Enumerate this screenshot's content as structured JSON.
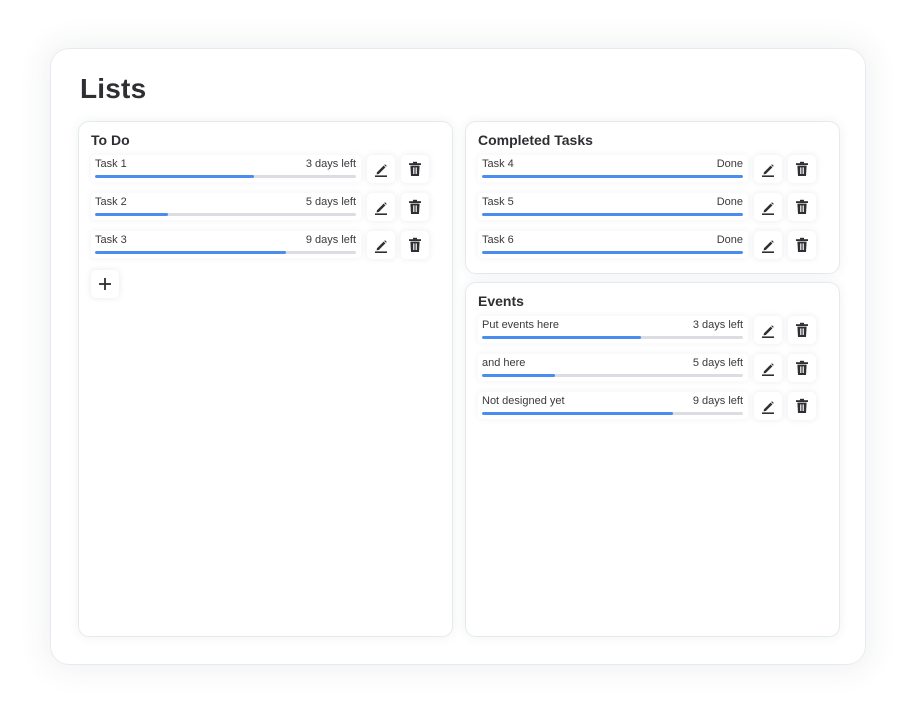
{
  "page": {
    "title": "Lists"
  },
  "colors": {
    "accent": "#4a8cf0",
    "track": "#dcdde2",
    "text": "#2f2f33"
  },
  "icons": {
    "edit": "pencil-icon",
    "delete": "trash-icon",
    "add": "plus-icon"
  },
  "lists": {
    "todo": {
      "title": "To Do",
      "items": [
        {
          "name": "Task 1",
          "status": "3 days left",
          "progress": 0.61
        },
        {
          "name": "Task 2",
          "status": "5 days left",
          "progress": 0.28
        },
        {
          "name": "Task 3",
          "status": "9 days left",
          "progress": 0.73
        }
      ]
    },
    "completed": {
      "title": "Completed Tasks",
      "items": [
        {
          "name": "Task 4",
          "status": "Done",
          "progress": 1.0
        },
        {
          "name": "Task 5",
          "status": "Done",
          "progress": 1.0
        },
        {
          "name": "Task 6",
          "status": "Done",
          "progress": 1.0
        }
      ]
    },
    "events": {
      "title": "Events",
      "items": [
        {
          "name": "Put events here",
          "status": "3 days left",
          "progress": 0.61
        },
        {
          "name": "and here",
          "status": "5 days left",
          "progress": 0.28
        },
        {
          "name": "Not designed yet",
          "status": "9 days left",
          "progress": 0.73
        }
      ]
    }
  }
}
